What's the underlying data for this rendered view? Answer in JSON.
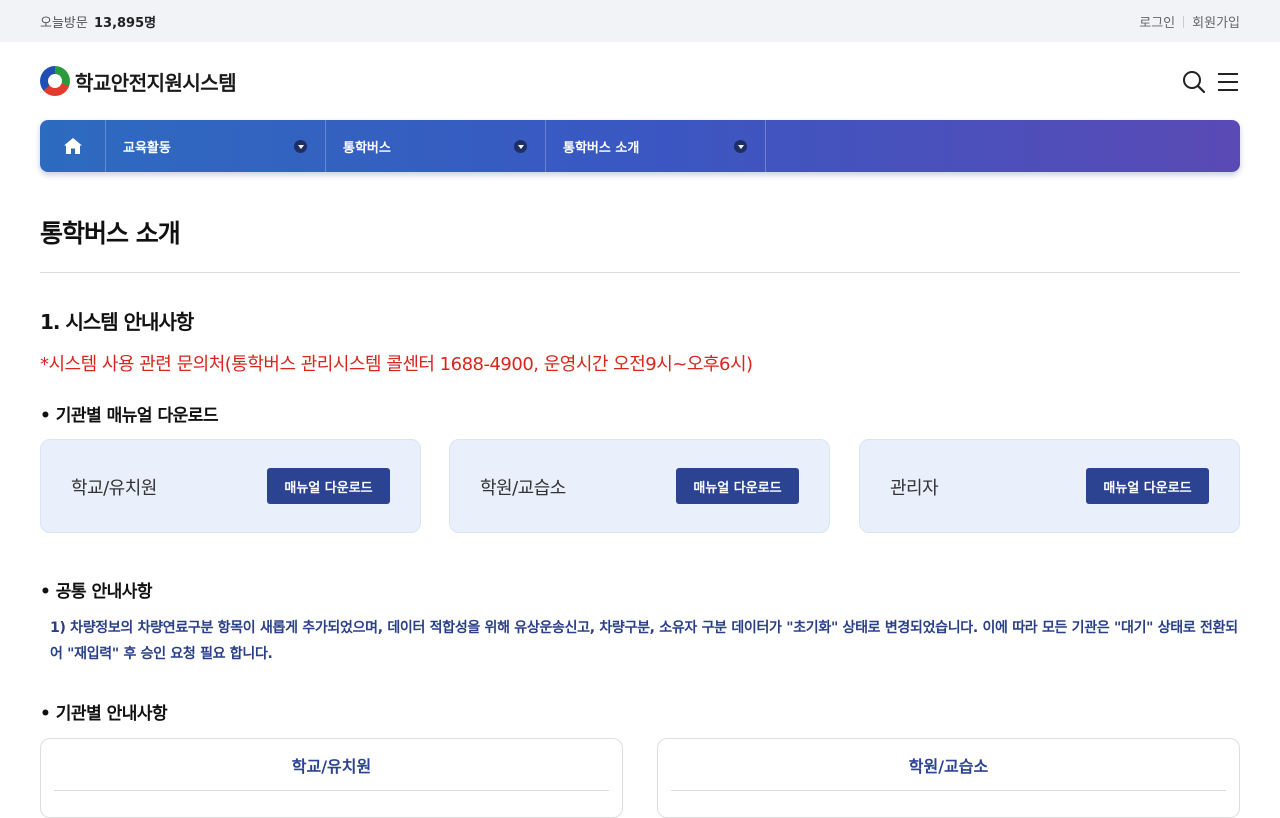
{
  "topbar": {
    "visitor_label": "오늘방문",
    "visitor_count": "13,895명",
    "login": "로그인",
    "signup": "회원가입"
  },
  "header": {
    "site_name": "학교안전지원시스템",
    "icons": [
      "search-icon",
      "hamburger-menu-icon"
    ]
  },
  "nav": {
    "home_icon": "home-icon",
    "menus": [
      {
        "label": "교육활동"
      },
      {
        "label": "통학버스"
      },
      {
        "label": "통학버스 소개"
      }
    ],
    "gradient_colors": [
      "#2d6bbf",
      "#5a4ab5"
    ]
  },
  "page": {
    "title": "통학버스 소개",
    "section1_title": "1. 시스템 안내사항",
    "contact_notice": "*시스템 사용 관련 문의처(통학버스 관리시스템 콜센터 1688-4900, 운영시간 오전9시~오후6시)",
    "manual_heading": "• 기관별 매뉴얼 다운로드",
    "manual_cards": [
      {
        "name": "학교/유치원",
        "button": "매뉴얼 다운로드"
      },
      {
        "name": "학원/교습소",
        "button": "매뉴얼 다운로드"
      },
      {
        "name": "관리자",
        "button": "매뉴얼 다운로드"
      }
    ],
    "common_heading": "• 공통 안내사항",
    "common_notice": "1) 차량정보의 차량연료구분 항목이 새롭게 추가되었으며, 데이터 적합성을 위해 유상운송신고, 차량구분, 소유자 구분 데이터가 \"초기화\" 상태로 변경되었습니다. 이에 따라 모든 기관은 \"대기\" 상태로 전환되어 \"재입력\" 후 승인 요청 필요 합니다.",
    "institution_heading": "• 기관별 안내사항",
    "institution_cards": [
      {
        "title": "학교/유치원"
      },
      {
        "title": "학원/교습소"
      }
    ]
  },
  "colors": {
    "accent_red": "#d8261c",
    "button_navy": "#2c4392",
    "card_bg": "#e9f0fb"
  }
}
